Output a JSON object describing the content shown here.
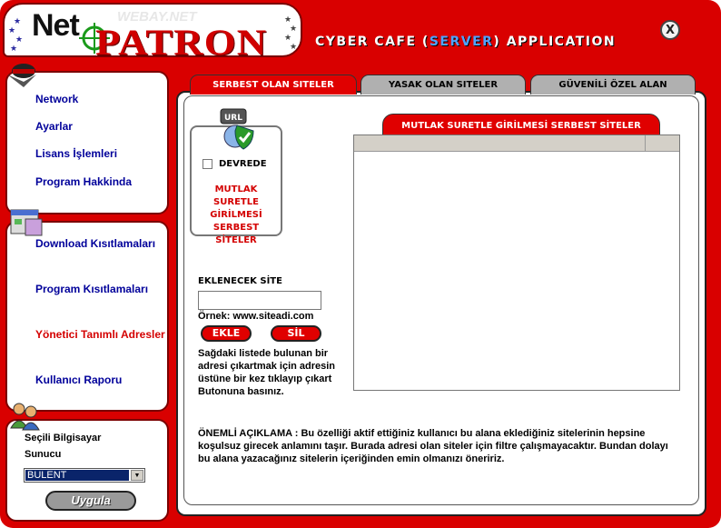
{
  "header": {
    "brand_net": "Net",
    "brand_webay": "WEBAY.NET",
    "brand_patron": "PATRON",
    "title_before": "CYBER CAFE (",
    "title_highlight": "SERVER",
    "title_after": ") APPLICATION",
    "close_label": "X"
  },
  "sidebar": {
    "menu1": [
      "Network",
      "Ayarlar",
      "Lisans İşlemleri",
      "Program Hakkinda"
    ],
    "menu2": [
      "Download Kısıtlamaları",
      "Program Kısıtlamaları",
      "Yönetici Tanımlı Adresler",
      "Kullanıcı Raporu"
    ],
    "selected_computer_label": "Seçili Bilgisayar",
    "server_label": "Sunucu",
    "server_value": "BULENT",
    "apply_label": "Uygula"
  },
  "tabs": [
    "SERBEST OLAN SITELER",
    "YASAK OLAN SITELER",
    "GÜVENİLİ ÖZEL ALAN"
  ],
  "main": {
    "checkbox_label": "DEVREDE",
    "checkbox_checked": false,
    "allowed_caption_1": "MUTLAK SURETLE",
    "allowed_caption_2": "GİRİLMESİ",
    "allowed_caption_3": "SERBEST SİTELER",
    "url_icon_text": "URL",
    "add_site_label": "EKLENECEK SİTE",
    "site_input_value": "",
    "example_text": "Örnek: www.siteadi.com",
    "add_button": "EKLE",
    "delete_button": "SİL",
    "help_text": "Sağdaki listede bulunan bir adresi  çıkartmak için adresin üstüne bir kez tıklayıp çıkart Butonuna basınız.",
    "list_title": "MUTLAK SURETLE GİRİLMESİ SERBEST SİTELER",
    "note": "ÖNEMLİ AÇIKLAMA : Bu özelliği aktif ettiğiniz kullanıcı bu alana eklediğiniz sitelerinin hepsine koşulsuz girecek anlamını taşır. Burada adresi olan siteler için filtre çalışmayacaktır. Bundan dolayı bu alana yazacağınız sitelerin içeriğinden emin olmanızı öneririz."
  },
  "colors": {
    "frame_red": "#d90000",
    "link_blue": "#00009a",
    "link_red": "#d40000",
    "server_highlight": "#4fa3ff"
  }
}
